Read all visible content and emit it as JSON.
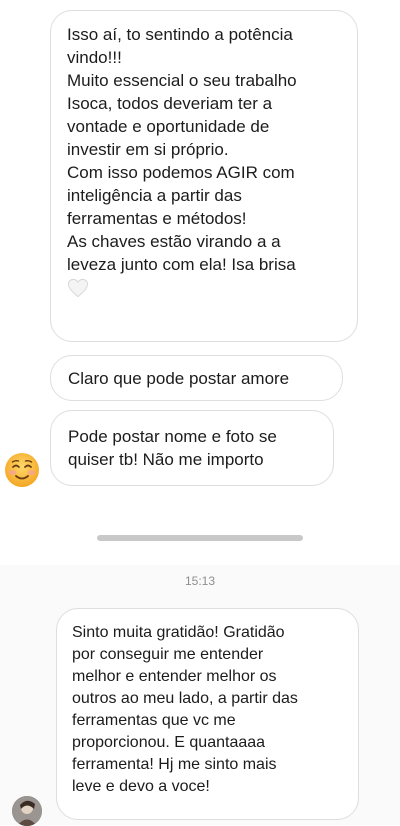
{
  "chat": {
    "messages": [
      {
        "text": "Isso aí, to sentindo a potência\nvindo!!!\nMuito essencial o seu trabalho\nIsoca, todos deveriam ter a\nvontade e oportunidade de\ninvestir em si próprio.\nCom isso podemos AGIR com\ninteligência a partir das\nferramentas e métodos!\nAs chaves estão virando a a\nleveza junto com ela! Isa brisa",
        "emoji": "white-heart-icon"
      },
      {
        "text": "Claro que pode postar amore"
      },
      {
        "text": "Pode postar nome e foto se\nquiser tb! Não me importo"
      },
      {
        "text": "Sinto muita gratidão! Gratidão\npor conseguir me entender\nmelhor e entender melhor os\noutros ao meu lado, a partir das\nferramentas que vc me\nproporcionou. E quantaaaa\nferramenta! Hj me sinto mais\nleve e devo a voce!"
      }
    ],
    "timestamp": "15:13",
    "avatars": {
      "sender_emoji": "smiling-face-emoji-icon",
      "sender_photo": "profile-photo"
    }
  },
  "colors": {
    "bubble_border": "#dedede",
    "bubble_background": "#ffffff",
    "text": "#1c1c1c",
    "timestamp": "#8e8e8e",
    "divider": "#c8c8c8"
  }
}
